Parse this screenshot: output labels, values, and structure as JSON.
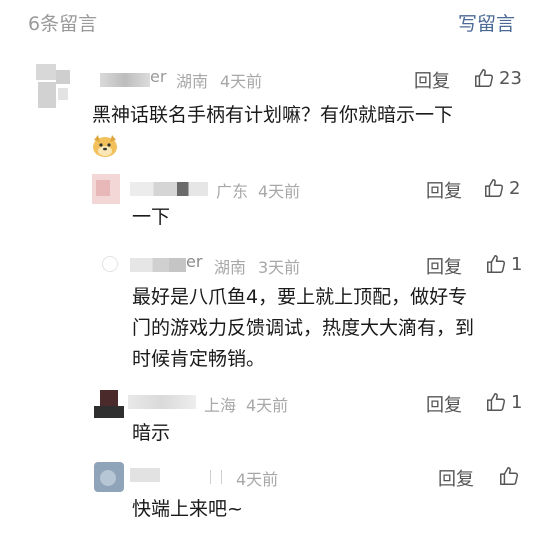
{
  "header": {
    "count_label": "6条留言",
    "write_label": "写留言"
  },
  "comments": [
    {
      "name_suffix": "er",
      "location": "湖南",
      "time": "4天前",
      "reply_label": "回复",
      "likes": "23",
      "text": "黑神话联名手柄有计划嘛？有你就暗示一下",
      "emoji": "doge-emoji"
    },
    {
      "name_suffix": "",
      "location": "广东",
      "time": "4天前",
      "reply_label": "回复",
      "likes": "2",
      "text": "一下"
    },
    {
      "name_suffix": "er",
      "location": "湖南",
      "time": "3天前",
      "reply_label": "回复",
      "likes": "1",
      "text_lines": [
        "最好是八爪鱼4，要上就上顶配，做好专",
        "门的游戏力反馈调试，热度大大滴有，到",
        "时候肯定畅销。"
      ]
    },
    {
      "name_suffix": "",
      "location": "上海",
      "time": "4天前",
      "reply_label": "回复",
      "likes": "1",
      "text": "暗示"
    },
    {
      "name_suffix": "",
      "location": "",
      "time": "4天前",
      "reply_label": "回复",
      "likes": "",
      "text": "快端上来吧~"
    }
  ],
  "colors": {
    "link": "#4b6a96",
    "muted": "#9a9a9a",
    "text": "#1a1a1a"
  },
  "icons": {
    "like": "thumbs-up-icon"
  }
}
